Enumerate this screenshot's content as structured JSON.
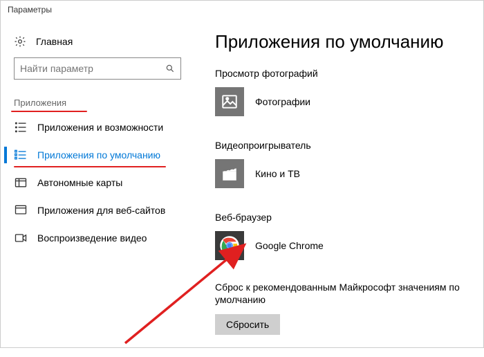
{
  "titlebar": "Параметры",
  "sidebar": {
    "home_label": "Главная",
    "search_placeholder": "Найти параметр",
    "section_label": "Приложения",
    "items": [
      {
        "label": "Приложения и возможности"
      },
      {
        "label": "Приложения по умолчанию"
      },
      {
        "label": "Автономные карты"
      },
      {
        "label": "Приложения для веб-сайтов"
      },
      {
        "label": "Воспроизведение видео"
      }
    ]
  },
  "main": {
    "title": "Приложения по умолчанию",
    "photo_viewer": {
      "heading": "Просмотр фотографий",
      "app": "Фотографии"
    },
    "video_player": {
      "heading": "Видеопроигрыватель",
      "app": "Кино и ТВ"
    },
    "web_browser": {
      "heading": "Веб-браузер",
      "app": "Google Chrome"
    },
    "reset": {
      "label": "Сброс к рекомендованным Майкрософт значениям по умолчанию",
      "button": "Сбросить"
    }
  }
}
